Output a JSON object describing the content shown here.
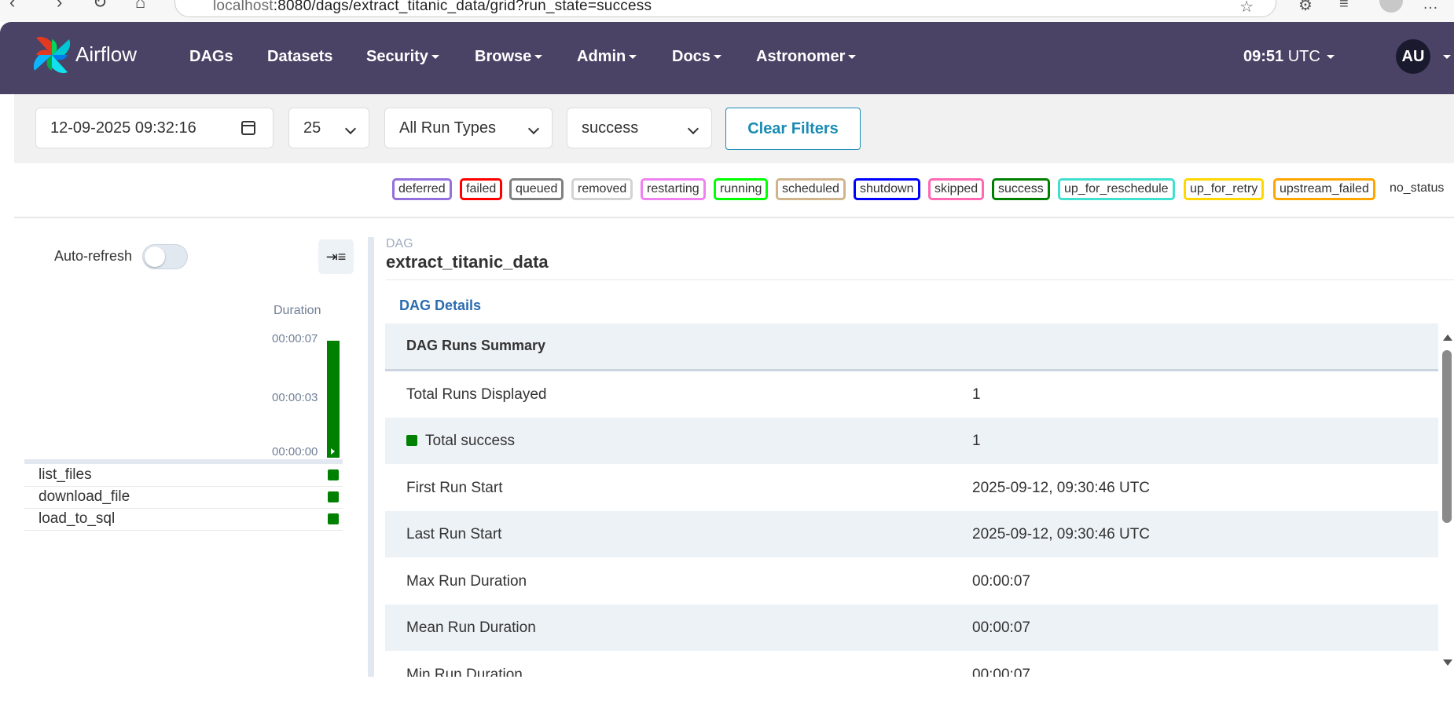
{
  "browser": {
    "url_host": "localhost",
    "url_rest": ":8080/dags/extract_titanic_data/grid?run_state=success"
  },
  "navbar": {
    "brand": "Airflow",
    "items": [
      {
        "label": "DAGs",
        "dropdown": false
      },
      {
        "label": "Datasets",
        "dropdown": false
      },
      {
        "label": "Security",
        "dropdown": true
      },
      {
        "label": "Browse",
        "dropdown": true
      },
      {
        "label": "Admin",
        "dropdown": true
      },
      {
        "label": "Docs",
        "dropdown": true
      },
      {
        "label": "Astronomer",
        "dropdown": true
      }
    ],
    "clock_time": "09:51",
    "clock_tz": "UTC",
    "user_initials": "AU",
    "bg_color": "#4a4366"
  },
  "filters": {
    "base_date": "12-09-2025 09:32:16",
    "num_runs": "25",
    "run_type": "All Run Types",
    "run_state": "success",
    "clear_label": "Clear Filters"
  },
  "legend": [
    {
      "label": "deferred",
      "color": "#9370db"
    },
    {
      "label": "failed",
      "color": "#ff0000"
    },
    {
      "label": "queued",
      "color": "#808080"
    },
    {
      "label": "removed",
      "color": "#d3d3d3"
    },
    {
      "label": "restarting",
      "color": "#ee82ee"
    },
    {
      "label": "running",
      "color": "#00ff00"
    },
    {
      "label": "scheduled",
      "color": "#d2b48c"
    },
    {
      "label": "shutdown",
      "color": "#0000ff"
    },
    {
      "label": "skipped",
      "color": "#ff69b4"
    },
    {
      "label": "success",
      "color": "#008000"
    },
    {
      "label": "up_for_reschedule",
      "color": "#40e0d0"
    },
    {
      "label": "up_for_retry",
      "color": "#ffd700"
    },
    {
      "label": "upstream_failed",
      "color": "#ffa500"
    },
    {
      "label": "no_status",
      "color": null
    }
  ],
  "grid": {
    "auto_refresh_label": "Auto-refresh",
    "auto_refresh_on": false,
    "duration_label": "Duration",
    "duration_ticks": [
      "00:00:07",
      "00:00:03",
      "00:00:00"
    ],
    "run_duration_seconds": 7,
    "tasks": [
      {
        "name": "list_files",
        "state": "success"
      },
      {
        "name": "download_file",
        "state": "success"
      },
      {
        "name": "load_to_sql",
        "state": "success"
      }
    ]
  },
  "details": {
    "breadcrumb_label": "DAG",
    "dag_id": "extract_titanic_data",
    "tab_label": "DAG Details",
    "summary_header": "DAG Runs Summary",
    "rows": [
      {
        "key": "Total Runs Displayed",
        "value": "1"
      },
      {
        "key": "Total success",
        "value": "1"
      },
      {
        "key": "First Run Start",
        "value": "2025-09-12, 09:30:46 UTC"
      },
      {
        "key": "Last Run Start",
        "value": "2025-09-12, 09:30:46 UTC"
      },
      {
        "key": "Max Run Duration",
        "value": "00:00:07"
      },
      {
        "key": "Mean Run Duration",
        "value": "00:00:07"
      },
      {
        "key": "Min Run Duration",
        "value": "00:00:07"
      }
    ]
  }
}
